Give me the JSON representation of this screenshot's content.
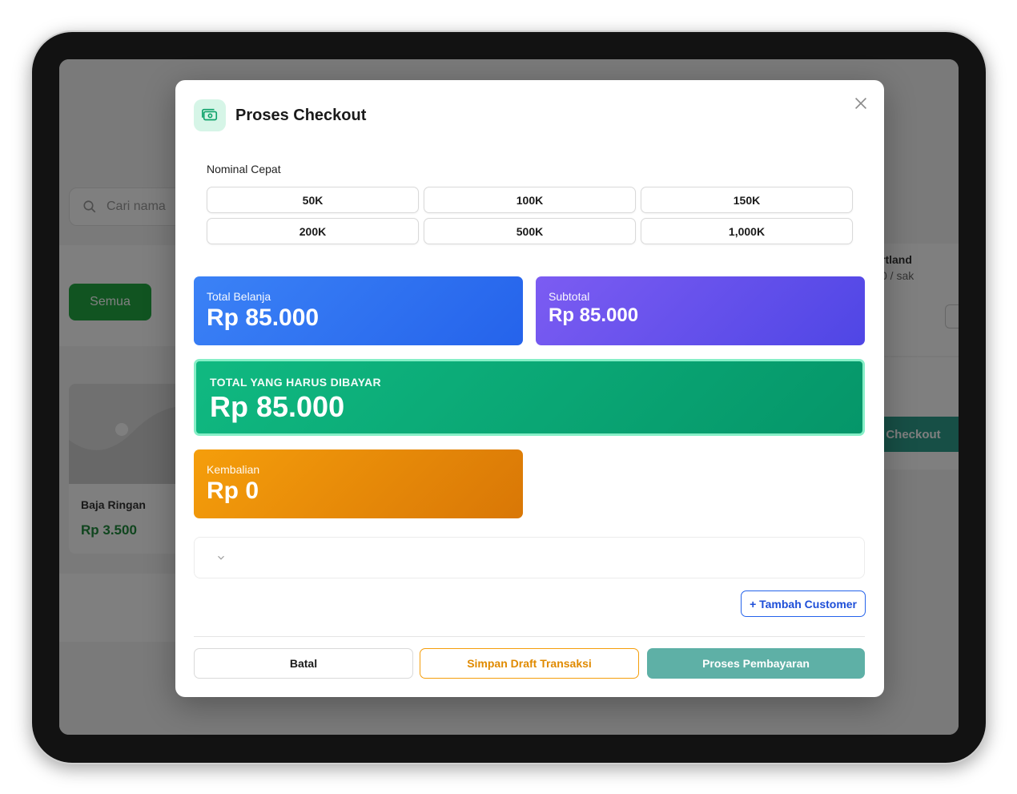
{
  "background": {
    "search_placeholder": "Cari nama",
    "filter_all_label": "Semua",
    "product_name": "Baja Ringan",
    "product_price": "Rp 3.500",
    "right_product_name": "rtland",
    "right_product_unit": "0 / sak",
    "checkout_label": "Checkout"
  },
  "modal": {
    "title": "Proses Checkout",
    "quick_label": "Nominal Cepat",
    "quick_amounts": [
      "50K",
      "100K",
      "150K",
      "200K",
      "500K",
      "1,000K"
    ],
    "total_belanja": {
      "label": "Total Belanja",
      "value": "Rp 85.000"
    },
    "subtotal": {
      "label": "Subtotal",
      "value": "Rp 85.000"
    },
    "total_bayar": {
      "label": "TOTAL YANG HARUS DIBAYAR",
      "value": "Rp 85.000"
    },
    "kembalian": {
      "label": "Kembalian",
      "value": "Rp 0"
    },
    "add_customer_label": "+ Tambah Customer",
    "cancel_label": "Batal",
    "draft_label": "Simpan Draft Transaksi",
    "pay_label": "Proses Pembayaran"
  },
  "colors": {
    "blue": "#2563eb",
    "purple": "#4f46e5",
    "green": "#059669",
    "orange": "#d97706",
    "teal_button": "#5eb0a6"
  }
}
